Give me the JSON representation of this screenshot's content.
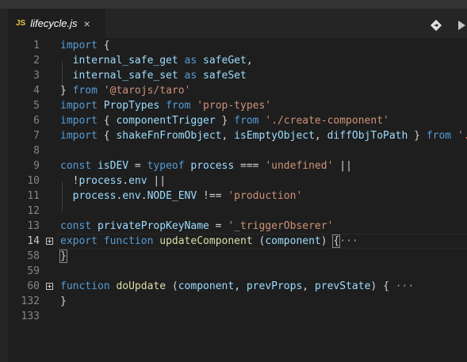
{
  "tab": {
    "icon": "JS",
    "filename": "lifecycle.js",
    "close": "×"
  },
  "toolbar": {
    "compare_icon": "compare-changes-icon",
    "run_icon": "play-icon"
  },
  "colors": {
    "keyword": "#569cd6",
    "variable": "#9cdcfe",
    "function": "#dcdcaa",
    "string": "#ce9178",
    "type": "#4ec9b0",
    "plain": "#d4d4d4",
    "line_number": "#858585",
    "line_number_active": "#c6c6c6",
    "background": "#1e1e1e"
  },
  "lines": [
    {
      "n": "1",
      "tokens": [
        [
          "kw",
          "import"
        ],
        [
          "pl",
          " "
        ],
        [
          "br",
          "{"
        ]
      ]
    },
    {
      "n": "2",
      "tokens": [
        [
          "pl",
          "  "
        ],
        [
          "var",
          "internal_safe_get"
        ],
        [
          "pl",
          " "
        ],
        [
          "kw",
          "as"
        ],
        [
          "pl",
          " "
        ],
        [
          "var",
          "safeGet"
        ],
        [
          "pl",
          ","
        ]
      ]
    },
    {
      "n": "3",
      "tokens": [
        [
          "pl",
          "  "
        ],
        [
          "var",
          "internal_safe_set"
        ],
        [
          "pl",
          " "
        ],
        [
          "kw",
          "as"
        ],
        [
          "pl",
          " "
        ],
        [
          "var",
          "safeSet"
        ]
      ]
    },
    {
      "n": "4",
      "tokens": [
        [
          "br",
          "}"
        ],
        [
          "pl",
          " "
        ],
        [
          "kw",
          "from"
        ],
        [
          "pl",
          " "
        ],
        [
          "str",
          "'@tarojs/taro'"
        ]
      ]
    },
    {
      "n": "5",
      "tokens": [
        [
          "kw",
          "import"
        ],
        [
          "pl",
          " "
        ],
        [
          "var",
          "PropTypes"
        ],
        [
          "pl",
          " "
        ],
        [
          "kw",
          "from"
        ],
        [
          "pl",
          " "
        ],
        [
          "str",
          "'prop-types'"
        ]
      ]
    },
    {
      "n": "6",
      "tokens": [
        [
          "kw",
          "import"
        ],
        [
          "pl",
          " "
        ],
        [
          "br",
          "{"
        ],
        [
          "pl",
          " "
        ],
        [
          "var",
          "componentTrigger"
        ],
        [
          "pl",
          " "
        ],
        [
          "br",
          "}"
        ],
        [
          "pl",
          " "
        ],
        [
          "kw",
          "from"
        ],
        [
          "pl",
          " "
        ],
        [
          "str",
          "'./create-component'"
        ]
      ]
    },
    {
      "n": "7",
      "tokens": [
        [
          "kw",
          "import"
        ],
        [
          "pl",
          " "
        ],
        [
          "br",
          "{"
        ],
        [
          "pl",
          " "
        ],
        [
          "var",
          "shakeFnFromObject"
        ],
        [
          "pl",
          ", "
        ],
        [
          "var",
          "isEmptyObject"
        ],
        [
          "pl",
          ", "
        ],
        [
          "var",
          "diffObjToPath"
        ],
        [
          "pl",
          " "
        ],
        [
          "br",
          "}"
        ],
        [
          "pl",
          " "
        ],
        [
          "kw",
          "from"
        ],
        [
          "pl",
          " "
        ],
        [
          "str",
          "'./"
        ]
      ]
    },
    {
      "n": "8",
      "tokens": []
    },
    {
      "n": "9",
      "tokens": [
        [
          "kw",
          "const"
        ],
        [
          "pl",
          " "
        ],
        [
          "var",
          "isDEV"
        ],
        [
          "pl",
          " = "
        ],
        [
          "kw",
          "typeof"
        ],
        [
          "pl",
          " "
        ],
        [
          "var",
          "process"
        ],
        [
          "pl",
          " === "
        ],
        [
          "str",
          "'undefined'"
        ],
        [
          "pl",
          " ||"
        ]
      ]
    },
    {
      "n": "10",
      "tokens": [
        [
          "pl",
          "  !"
        ],
        [
          "var",
          "process"
        ],
        [
          "pl",
          "."
        ],
        [
          "var",
          "env"
        ],
        [
          "pl",
          " ||"
        ]
      ]
    },
    {
      "n": "11",
      "tokens": [
        [
          "pl",
          "  "
        ],
        [
          "var",
          "process"
        ],
        [
          "pl",
          "."
        ],
        [
          "var",
          "env"
        ],
        [
          "pl",
          "."
        ],
        [
          "var",
          "NODE_ENV"
        ],
        [
          "pl",
          " !== "
        ],
        [
          "str",
          "'production'"
        ]
      ]
    },
    {
      "n": "12",
      "tokens": []
    },
    {
      "n": "13",
      "tokens": [
        [
          "kw",
          "const"
        ],
        [
          "pl",
          " "
        ],
        [
          "var",
          "privatePropKeyName"
        ],
        [
          "pl",
          " = "
        ],
        [
          "str",
          "'_triggerObserer'"
        ]
      ]
    },
    {
      "n": "14",
      "tokens": [
        [
          "kw",
          "export"
        ],
        [
          "pl",
          " "
        ],
        [
          "kw",
          "function"
        ],
        [
          "pl",
          " "
        ],
        [
          "fn",
          "updateComponent"
        ],
        [
          "pl",
          " ("
        ],
        [
          "var",
          "component"
        ],
        [
          "pl",
          ") "
        ],
        [
          "brm",
          "{"
        ],
        [
          "ell",
          "···"
        ]
      ],
      "active": true,
      "fold": true
    },
    {
      "n": "58",
      "tokens": [
        [
          "brm",
          "}"
        ]
      ]
    },
    {
      "n": "59",
      "tokens": []
    },
    {
      "n": "60",
      "tokens": [
        [
          "kw",
          "function"
        ],
        [
          "pl",
          " "
        ],
        [
          "fn",
          "doUpdate"
        ],
        [
          "pl",
          " ("
        ],
        [
          "var",
          "component"
        ],
        [
          "pl",
          ", "
        ],
        [
          "var",
          "prevProps"
        ],
        [
          "pl",
          ", "
        ],
        [
          "var",
          "prevState"
        ],
        [
          "pl",
          ") "
        ],
        [
          "br",
          "{"
        ],
        [
          "ell",
          " ···"
        ]
      ],
      "fold": true
    },
    {
      "n": "132",
      "tokens": [
        [
          "br",
          "}"
        ]
      ]
    },
    {
      "n": "133",
      "tokens": []
    }
  ]
}
